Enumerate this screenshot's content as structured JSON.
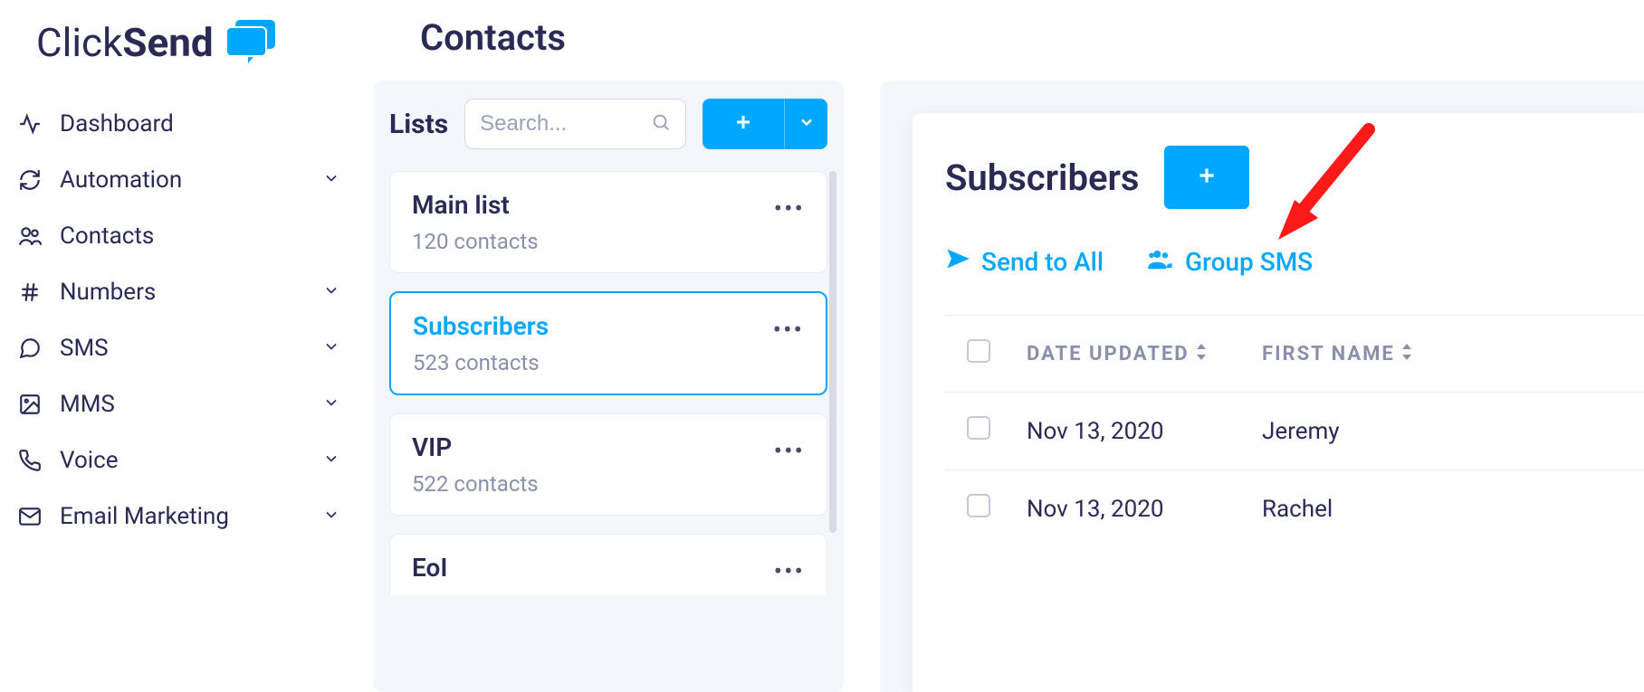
{
  "logo": {
    "part1": "Click",
    "part2": "Send"
  },
  "nav": [
    {
      "label": "Dashboard",
      "icon": "activity",
      "expandable": false
    },
    {
      "label": "Automation",
      "icon": "sync",
      "expandable": true
    },
    {
      "label": "Contacts",
      "icon": "users",
      "expandable": false
    },
    {
      "label": "Numbers",
      "icon": "hash",
      "expandable": true
    },
    {
      "label": "SMS",
      "icon": "chat",
      "expandable": true
    },
    {
      "label": "MMS",
      "icon": "image",
      "expandable": true
    },
    {
      "label": "Voice",
      "icon": "phone",
      "expandable": true
    },
    {
      "label": "Email Marketing",
      "icon": "mail",
      "expandable": true
    }
  ],
  "page": {
    "title": "Contacts"
  },
  "lists_panel": {
    "label": "Lists",
    "search_placeholder": "Search...",
    "items": [
      {
        "name": "Main list",
        "count": "120 contacts",
        "selected": false
      },
      {
        "name": "Subscribers",
        "count": "523 contacts",
        "selected": true
      },
      {
        "name": "VIP",
        "count": "522 contacts",
        "selected": false
      },
      {
        "name": "EoI",
        "count": null,
        "selected": false
      }
    ]
  },
  "detail": {
    "title": "Subscribers",
    "actions": {
      "send_all": "Send to All",
      "group_sms": "Group SMS"
    },
    "columns": {
      "date": "DATE UPDATED",
      "first_name": "FIRST NAME"
    },
    "rows": [
      {
        "date": "Nov 13, 2020",
        "first_name": "Jeremy"
      },
      {
        "date": "Nov 13, 2020",
        "first_name": "Rachel"
      }
    ]
  },
  "colors": {
    "accent": "#00a7ff"
  }
}
